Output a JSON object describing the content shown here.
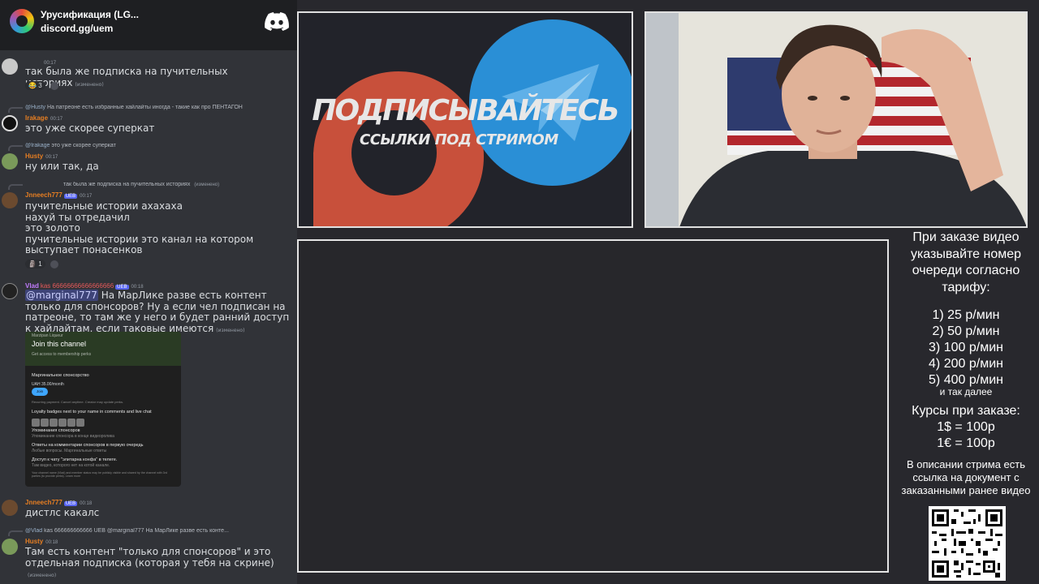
{
  "chat": {
    "server_name": "Урусификация (LG...",
    "server_link": "discord.gg/uem",
    "messages": {
      "m1": {
        "time": "00:17",
        "text": "так была же подписка на пучительных историях",
        "edited": "(изменено)",
        "reaction_count": "3"
      },
      "m2": {
        "reply_name": "@Husty",
        "reply_text": "На патреоне есть избранные хайлайты иногда - такие как про ПЕНТАГОН",
        "user": "Irakage",
        "time": "00:17",
        "text": "это уже скорее суперкат"
      },
      "m3": {
        "reply_name": "@Irakage",
        "reply_text": "это уже скорее суперкат",
        "user": "Husty",
        "time": "00:17",
        "text": "ну или так, да"
      },
      "m4": {
        "reply_text": "так была же подписка на пучительных историях",
        "reply_edited": "(изменено)",
        "user": "Jnneech777",
        "badge": "UEB",
        "time": "00:17",
        "lines": [
          "пучительные истории ахахаха",
          "нахуй ты отредачил",
          "это золото",
          "пучительные истории это канал на котором",
          "выступает понасенков"
        ],
        "reaction_count": "1"
      },
      "m5": {
        "user": "Vlad",
        "user_rest": "kas 66666666666666666",
        "badge": "UEB",
        "time": "00:18",
        "mention": "@marginal777",
        "text_rest": " На МарЛике разве есть контент только для спонсоров? Ну а если чел подписан на патреоне, то там же у него и будет ранний доступ к хайлайтам, если таковые имеются",
        "edited": "(изменено)"
      },
      "m6": {
        "user": "Jnneech777",
        "badge": "UEB",
        "time": "00:18",
        "text": "дистлс какалс"
      },
      "m7": {
        "reply_name": "@Vlad",
        "reply_text": "kas 666666666666 UEB @marginal777 На МарЛике разве есть конте...",
        "user": "Husty",
        "time": "00:18",
        "text": "Там есть контент \"только для спонсоров\" и это отдельная подписка (которая у тебя на скрине)",
        "edited": "(изменено)"
      }
    },
    "embed": {
      "channel": "Marzipan Liqueur",
      "title": "Join this channel",
      "subtitle": "Get access to membership perks",
      "tier": "Маргинальное спонсорство",
      "price": "UAH 35.00/month",
      "join": "Join",
      "note": "Recurring payment. Cancel anytime. Creator may update perks.",
      "perk1": "Loyalty badges next to your name in comments and live chat",
      "perk2": "Упоминания спонсоров",
      "perk2_sub": "Упоминание спонсора в конце видеоролика",
      "perk3": "Ответы на комментарии спонсоров в первую очередь",
      "perk3_sub": "Любые вопросы. Маргинальные ответы",
      "perk4": "Доступ к чату \"элитарна конфа\" в телеге.",
      "perk4_sub": "Там видео, которого нет на котой канале.",
      "footer": "Your channel name (Vlad) and member status may be publicly visible and shared by the channel with 3rd parties (to provide perks). Learn more"
    }
  },
  "banner": {
    "title": "ПОДПИСЫВАЙТЕСЬ",
    "subtitle": "ССЫЛКИ ПОД СТРИМОМ"
  },
  "info": {
    "heading": "При заказе видео указывайте номер очереди согласно тарифу:",
    "tariffs": [
      "1) 25 р/мин",
      "2) 50 р/мин",
      "3) 100 р/мин",
      "4) 200 р/мин",
      "5) 400 р/мин"
    ],
    "etc": "и так далее",
    "rates_title": "Курсы при заказе:",
    "rates": [
      "1$ = 100р",
      "1€ = 100р"
    ],
    "description": "В описании стрима есть ссылка на документ с заказанными ранее видео"
  },
  "colors": {
    "discord_bg": "#313338",
    "patreon": "#c8503b",
    "telegram": "#2a8fd6",
    "frame_border": "#e4e4e4"
  }
}
